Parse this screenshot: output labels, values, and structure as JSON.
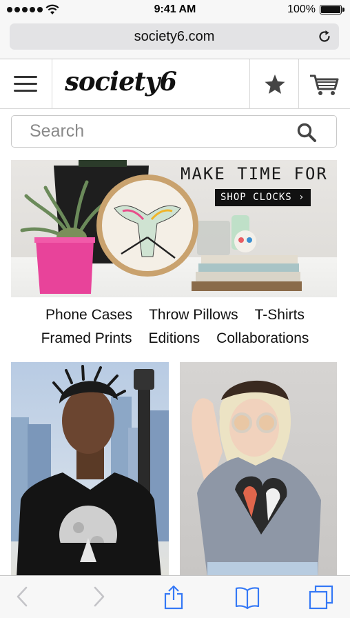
{
  "status_bar": {
    "time": "9:41 AM",
    "battery_percent": "100%",
    "signal_icon": "cellular-signal-icon",
    "wifi_icon": "wifi-icon",
    "battery_icon": "battery-icon"
  },
  "browser": {
    "url": "society6.com",
    "reload_icon": "reload-icon"
  },
  "site_header": {
    "logo_text": "society6",
    "menu_icon": "hamburger-menu-icon",
    "favorites_icon": "star-icon",
    "cart_icon": "shopping-cart-icon"
  },
  "search": {
    "placeholder": "Search",
    "icon": "search-icon"
  },
  "hero": {
    "title": "MAKE TIME FOR ART",
    "button_label": "SHOP CLOCKS ›"
  },
  "categories": {
    "row1": [
      "Phone Cases",
      "Throw Pillows",
      "T-Shirts"
    ],
    "row2": [
      "Framed Prints",
      "Editions",
      "Collaborations"
    ]
  },
  "products": [
    {
      "name": "product-tile-moon-tshirt"
    },
    {
      "name": "product-tile-heart-tshirt"
    }
  ],
  "toolbar": {
    "back_icon": "back-arrow-icon",
    "forward_icon": "forward-arrow-icon",
    "share_icon": "share-icon",
    "bookmarks_icon": "bookmarks-icon",
    "tabs_icon": "tabs-icon"
  },
  "colors": {
    "accent_ios_blue": "#3478f6",
    "pot_pink": "#e8439a",
    "hero_button_bg": "#111111"
  }
}
